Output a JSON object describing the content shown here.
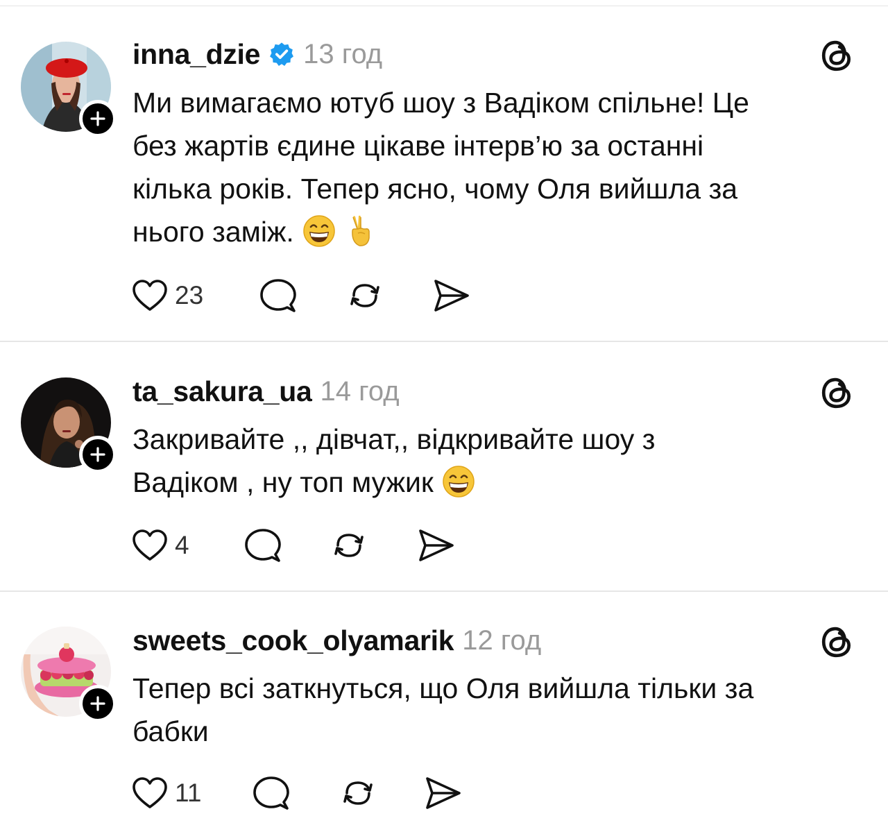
{
  "posts": [
    {
      "username": "inna_dzie",
      "verified": true,
      "time": "13 год",
      "lines": [
        "Ми вимагаємо ютуб шоу з Вадіком спільне! Це",
        "без жартів єдине цікаве інтерв’ю за останні",
        "кілька років. Тепер ясно, чому Оля вийшла за",
        "нього заміж."
      ],
      "emojis": [
        "grinning-face",
        "victory-hand"
      ],
      "likes": "23"
    },
    {
      "username": "ta_sakura_ua",
      "verified": false,
      "time": "14 год",
      "lines": [
        "Закривайте ,, дівчат,, відкривайте шоу з",
        "Вадіком , ну топ мужик"
      ],
      "emojis": [
        "grinning-face"
      ],
      "likes": "4"
    },
    {
      "username": "sweets_cook_olyamarik",
      "verified": false,
      "time": "12 год",
      "lines": [
        "Тепер всі заткнуться, що Оля вийшла тільки за",
        "бабки"
      ],
      "emojis": [],
      "likes": "11"
    }
  ],
  "icons": {
    "like": "heart-icon",
    "reply": "speech-bubble-icon",
    "repost": "repost-icon",
    "share": "send-icon",
    "brand": "threads-logo-icon",
    "follow": "plus-icon",
    "verified": "verified-badge-icon"
  },
  "colors": {
    "verified": "#1d9bf0",
    "time": "#9a9a9a",
    "divider": "#e6e6e6"
  }
}
